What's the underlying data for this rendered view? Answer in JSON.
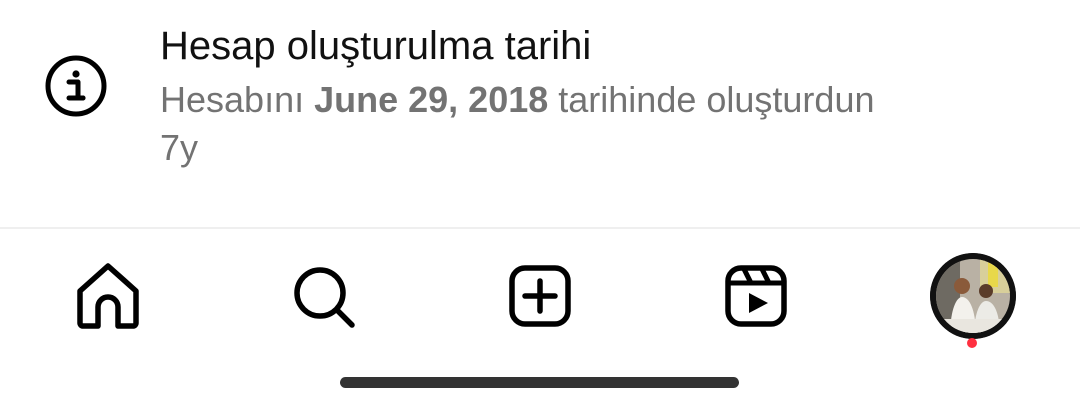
{
  "info": {
    "icon": "info-icon",
    "title": "Hesap oluşturulma tarihi",
    "description_prefix": "Hesabını ",
    "description_date": "June 29, 2018",
    "description_suffix": " tarihinde oluşturdun",
    "age": "7y"
  },
  "bottom_nav": {
    "items": [
      {
        "name": "home",
        "icon": "home-icon"
      },
      {
        "name": "search",
        "icon": "search-icon"
      },
      {
        "name": "create",
        "icon": "plus-square-icon"
      },
      {
        "name": "reels",
        "icon": "reels-icon"
      },
      {
        "name": "profile",
        "icon": "avatar"
      }
    ],
    "profile_notification": true
  },
  "colors": {
    "text_primary": "#111111",
    "text_secondary": "#737373",
    "notification": "#ff3040",
    "icon": "#000000"
  }
}
